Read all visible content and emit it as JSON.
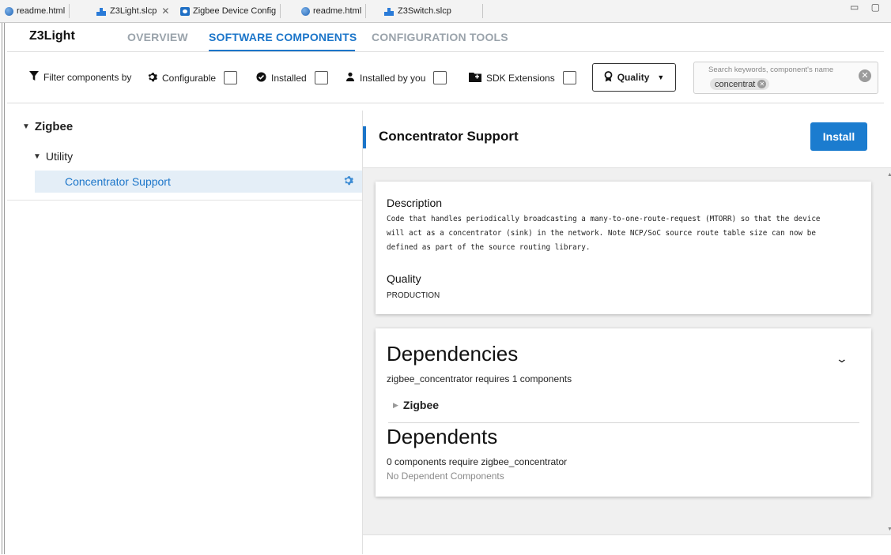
{
  "tabs": [
    {
      "label": "readme.html",
      "icon": "globe-icon"
    },
    {
      "label": "Z3Light.slcp",
      "icon": "slcp-project-icon",
      "close": "✕"
    },
    {
      "label": "Zigbee Device Config",
      "icon": "device-config-icon"
    },
    {
      "label": "readme.html",
      "icon": "globe-icon"
    },
    {
      "label": "Z3Switch.slcp",
      "icon": "slcp-project-icon"
    }
  ],
  "window_controls": "▭ ▢",
  "header": {
    "title": "Z3Light",
    "nav": [
      "OVERVIEW",
      "SOFTWARE COMPONENTS",
      "CONFIGURATION TOOLS"
    ],
    "active_nav": "SOFTWARE COMPONENTS"
  },
  "filters": {
    "label": "Filter components by",
    "configurable": "Configurable",
    "installed": "Installed",
    "installed_by_you": "Installed by you",
    "sdk_extensions": "SDK Extensions",
    "quality": "Quality",
    "search_placeholder": "Search keywords, component's name",
    "search_chip": "concentrat"
  },
  "tree": {
    "root": "Zigbee",
    "child": "Utility",
    "leaf": "Concentrator Support"
  },
  "detail": {
    "title": "Concentrator Support",
    "install_label": "Install",
    "description_heading": "Description",
    "description_lines": [
      "Code that handles periodically broadcasting a many-to-one-route-request (MTORR) so that the device",
      "will act as a concentrator (sink) in the network. Note NCP/SoC source route table size can now be",
      "defined as part of the source routing library."
    ],
    "quality_heading": "Quality",
    "quality_value": "PRODUCTION",
    "dependencies_heading": "Dependencies",
    "dependencies_summary": "zigbee_concentrator requires 1 components",
    "dependency_group": "Zigbee",
    "dependents_heading": "Dependents",
    "dependents_summary": "0 components require zigbee_concentrator",
    "dependents_empty": "No Dependent Components"
  },
  "colors": {
    "accent": "#1b75c9",
    "install_button": "#1b7ccf",
    "selected_row": "#e4eef7"
  }
}
